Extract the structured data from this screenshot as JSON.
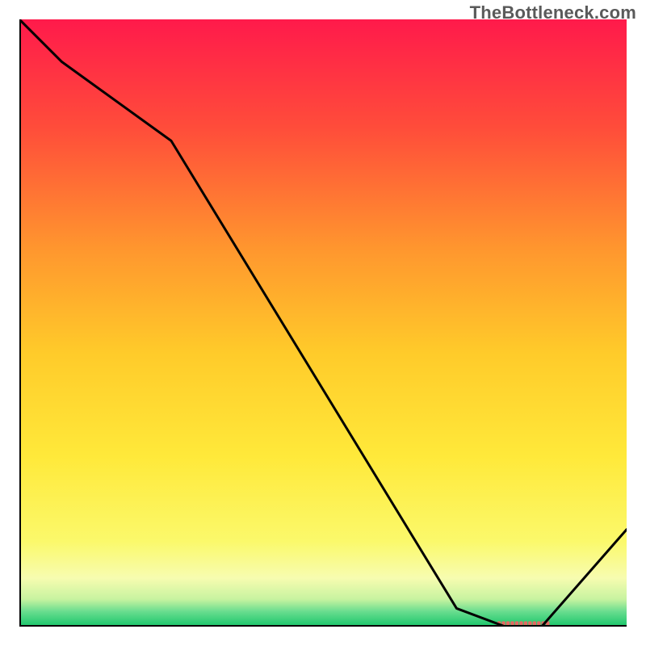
{
  "attribution": "TheBottleneck.com",
  "chart_data": {
    "type": "line",
    "title": "",
    "xlabel": "",
    "ylabel": "",
    "xlim": [
      0,
      100
    ],
    "ylim": [
      0,
      100
    ],
    "series": [
      {
        "name": "curve",
        "x": [
          0,
          7,
          25,
          72,
          80,
          86,
          100
        ],
        "y": [
          100,
          93,
          80,
          3,
          0,
          0,
          16
        ]
      }
    ],
    "marker_band": {
      "name": "highlight-band",
      "x_start": 79,
      "x_end": 87,
      "y": 0,
      "color": "#e46a63"
    },
    "background": {
      "type": "vertical-gradient",
      "stops": [
        {
          "offset": 0.0,
          "color": "#ff1a4b"
        },
        {
          "offset": 0.18,
          "color": "#ff4d3a"
        },
        {
          "offset": 0.38,
          "color": "#ff972e"
        },
        {
          "offset": 0.55,
          "color": "#ffcb2a"
        },
        {
          "offset": 0.72,
          "color": "#ffe93a"
        },
        {
          "offset": 0.86,
          "color": "#fbf96b"
        },
        {
          "offset": 0.92,
          "color": "#f7fcb0"
        },
        {
          "offset": 0.955,
          "color": "#c7f3a0"
        },
        {
          "offset": 0.975,
          "color": "#69dd8f"
        },
        {
          "offset": 1.0,
          "color": "#19c56a"
        }
      ]
    },
    "axis_color": "#000000",
    "axis_width": 4,
    "line_color": "#000000",
    "line_width": 3
  }
}
